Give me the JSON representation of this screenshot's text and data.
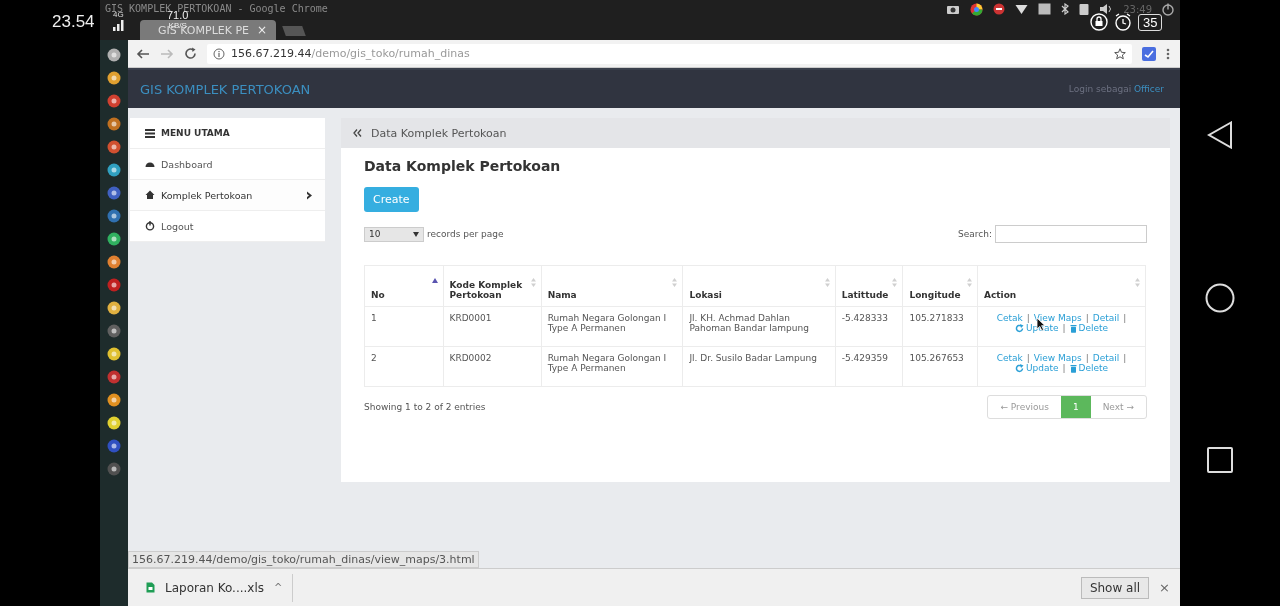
{
  "phone_status": {
    "time": "23.54",
    "network": "4G",
    "speed": "71.0",
    "speed_unit": "KB/S",
    "battery": "35"
  },
  "desktop_panel": {
    "title": "GIS KOMPLEK PERTOKOAN - Google Chrome",
    "clock": "23:49"
  },
  "dock": [
    {
      "color": "#b0b0b0"
    },
    {
      "color": "#e0a030"
    },
    {
      "color": "#d04030"
    },
    {
      "color": "#c07020"
    },
    {
      "color": "#d05030"
    },
    {
      "color": "#30a0c0"
    },
    {
      "color": "#4060c0"
    },
    {
      "color": "#3070b0"
    },
    {
      "color": "#30b060"
    },
    {
      "color": "#e08030"
    },
    {
      "color": "#c02020"
    },
    {
      "color": "#e0b040"
    },
    {
      "color": "#606060"
    },
    {
      "color": "#e0c030"
    },
    {
      "color": "#c03030"
    },
    {
      "color": "#e09020"
    },
    {
      "color": "#e0d030"
    },
    {
      "color": "#3050c0"
    },
    {
      "color": "#505050"
    }
  ],
  "browser": {
    "tab": {
      "title": "GIS KOMPLEK PE",
      "close": "×"
    },
    "url_host": "156.67.219.44",
    "url_path": "/demo/gis_toko/rumah_dinas",
    "status_url": "156.67.219.44/demo/gis_toko/rumah_dinas/view_maps/3.html",
    "download": {
      "file": "Laporan Ko....xls",
      "caret": "^",
      "show_all": "Show all",
      "close": "×"
    }
  },
  "navbar": {
    "brand": "GIS KOMPLEK PERTOKOAN",
    "login_label": "Login sebagai",
    "user": "Officer"
  },
  "sidebar": {
    "heading": "MENU UTAMA",
    "items": [
      {
        "label": "Dashboard",
        "selected": false,
        "expandable": false
      },
      {
        "label": "Komplek Pertokoan",
        "selected": true,
        "expandable": true
      },
      {
        "label": "Logout",
        "selected": false,
        "expandable": false
      }
    ]
  },
  "content": {
    "breadcrumb": "Data Komplek Pertokoan",
    "title": "Data Komplek Pertokoan",
    "create_button": "Create",
    "page_size": "10",
    "page_size_label": "records per page",
    "search_label": "Search:",
    "table": {
      "columns": [
        {
          "label": "No",
          "sorted": true
        },
        {
          "label": "Kode Komplek Pertokoan",
          "sorted": false
        },
        {
          "label": "Nama",
          "sorted": false
        },
        {
          "label": "Lokasi",
          "sorted": false
        },
        {
          "label": "Latittude",
          "sorted": false
        },
        {
          "label": "Longitude",
          "sorted": false
        },
        {
          "label": "Action",
          "sorted": false
        }
      ],
      "separator": "|",
      "rows": [
        {
          "cells": [
            "1",
            "KRD0001",
            " Rumah Negara Golongan I Type A Permanen",
            "Jl. KH. Achmad Dahlan Pahoman Bandar lampung",
            "-5.428333",
            "105.271833"
          ],
          "actions": [
            "Cetak",
            "View Maps",
            "Detail",
            "Update",
            "Delete"
          ],
          "hovered": true
        },
        {
          "cells": [
            "2",
            "KRD0002",
            "Rumah Negara Golongan I Type A Permanen",
            "Jl. Dr. Susilo Badar Lampung",
            "-5.429359",
            "105.267653"
          ],
          "actions": [
            "Cetak",
            "View Maps",
            "Detail",
            "Update",
            "Delete"
          ],
          "hovered": false
        }
      ]
    },
    "info": "Showing 1 to 2 of 2 entries",
    "pagination": [
      {
        "label": "← Previous",
        "selected": false,
        "disabled": true
      },
      {
        "label": "1",
        "selected": true,
        "disabled": false
      },
      {
        "label": "Next →",
        "selected": false,
        "disabled": true
      }
    ]
  }
}
